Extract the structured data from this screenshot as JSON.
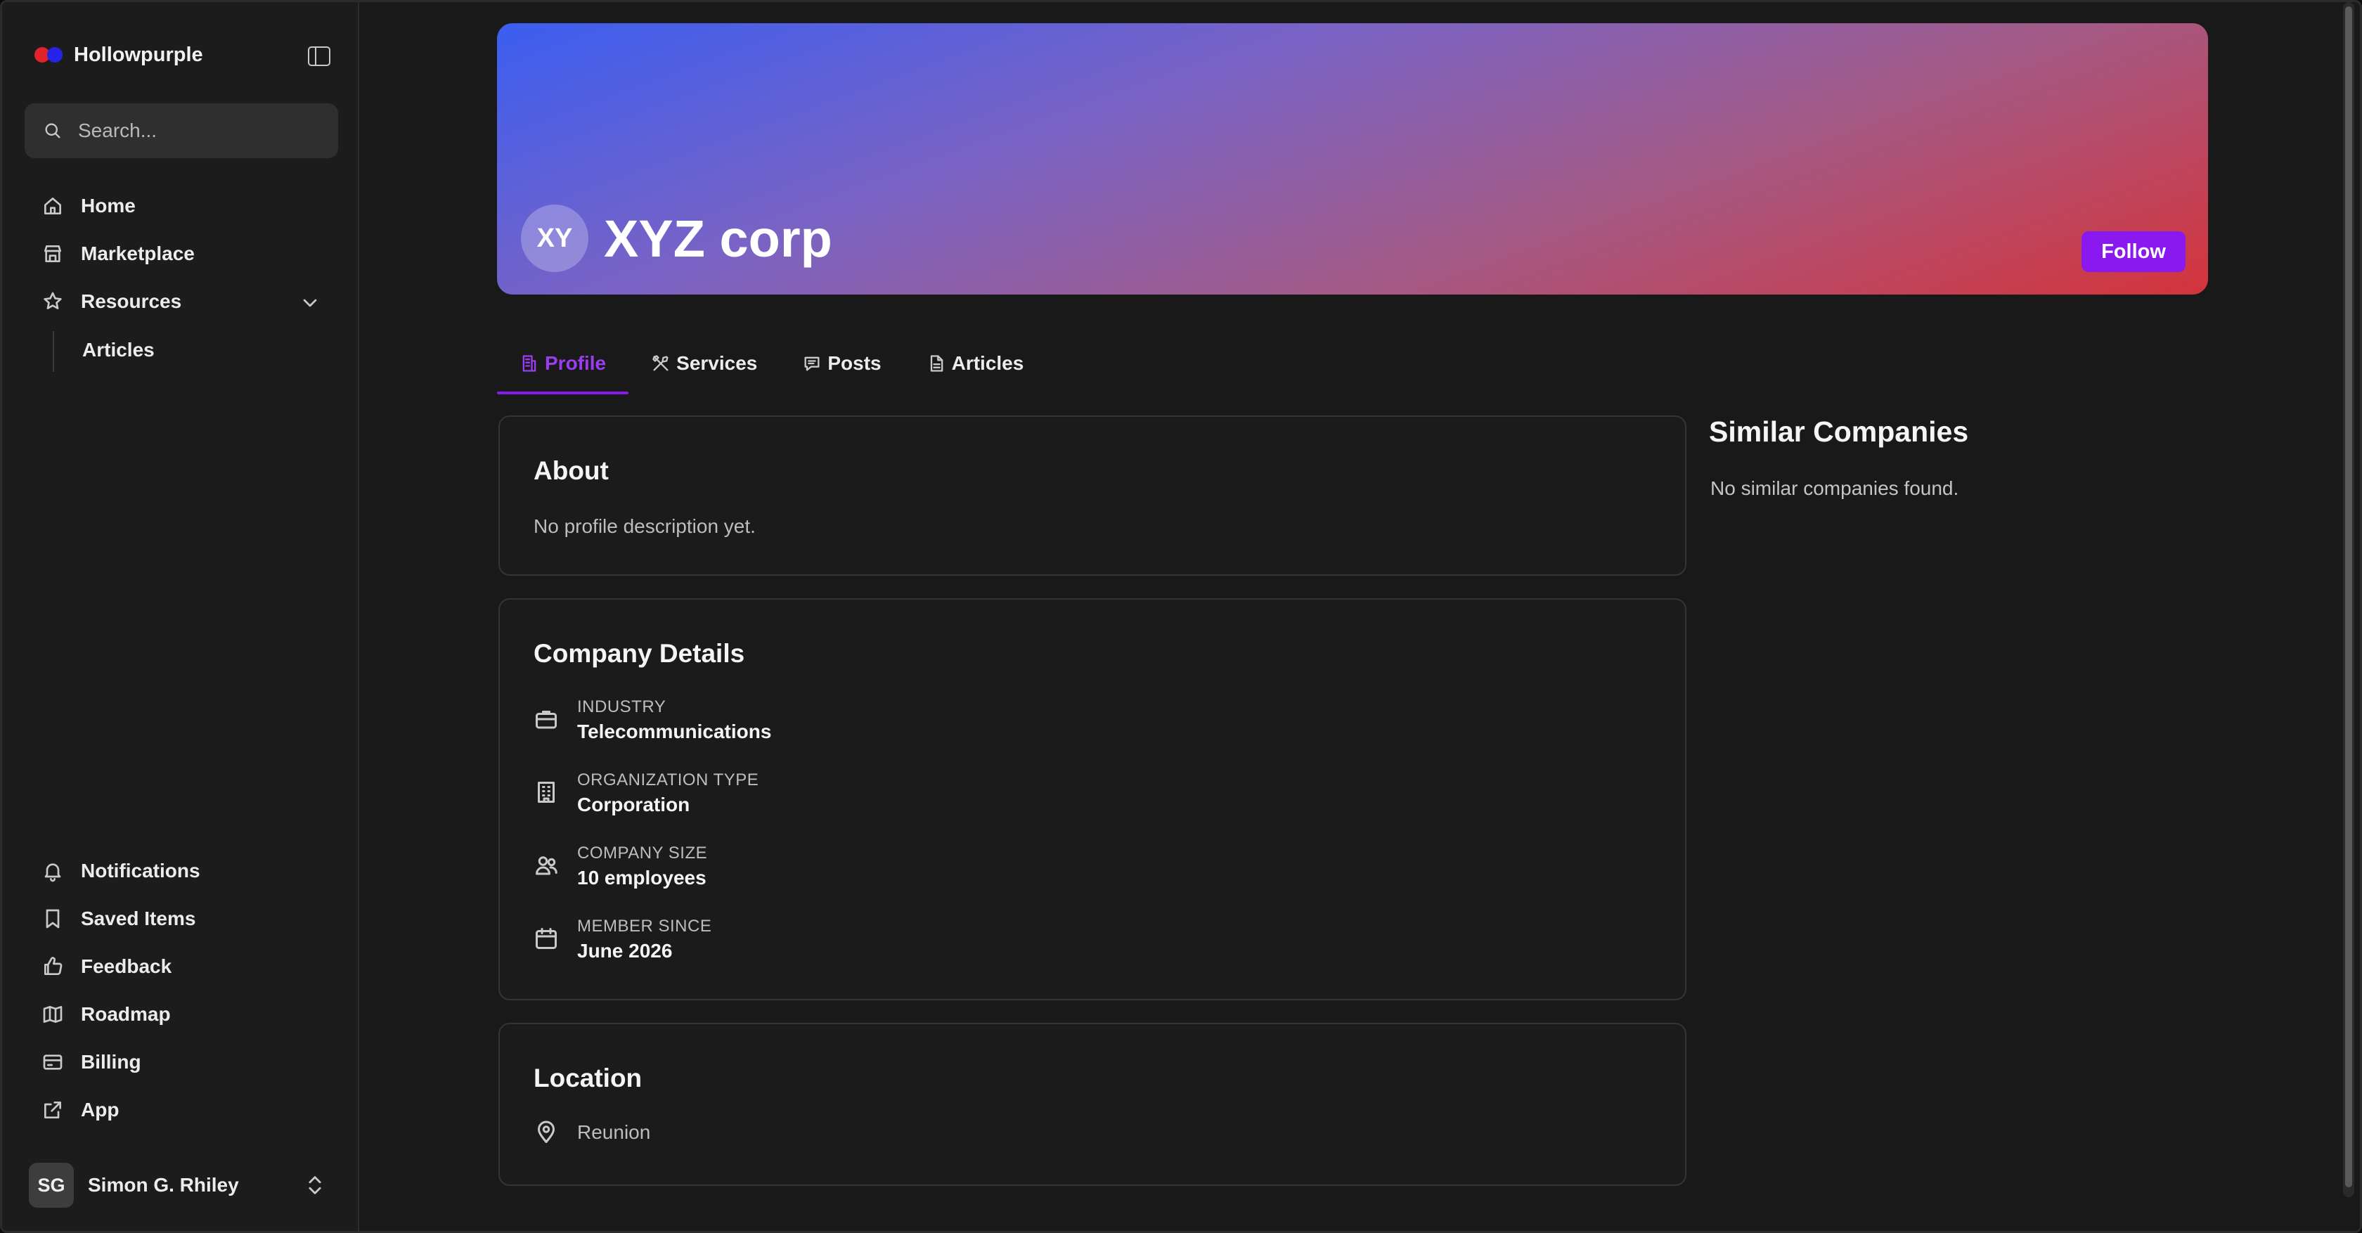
{
  "sidebar": {
    "brand": "Hollowpurple",
    "search_placeholder": "Search...",
    "nav": [
      {
        "label": "Home",
        "icon": "home-icon"
      },
      {
        "label": "Marketplace",
        "icon": "store-icon"
      },
      {
        "label": "Resources",
        "icon": "star-icon"
      }
    ],
    "subnav": [
      {
        "label": "Articles"
      }
    ],
    "bottom_nav": [
      {
        "label": "Notifications",
        "icon": "bell-icon"
      },
      {
        "label": "Saved Items",
        "icon": "bookmark-icon"
      },
      {
        "label": "Feedback",
        "icon": "thumbs-up-icon"
      },
      {
        "label": "Roadmap",
        "icon": "map-icon"
      },
      {
        "label": "Billing",
        "icon": "credit-card-icon"
      },
      {
        "label": "App",
        "icon": "external-link-icon"
      }
    ],
    "user": {
      "initials": "SG",
      "name": "Simon G. Rhiley"
    }
  },
  "company": {
    "initials": "XY",
    "name": "XYZ corp",
    "follow_label": "Follow"
  },
  "tabs": [
    {
      "label": "Profile",
      "icon": "building-icon",
      "active": true
    },
    {
      "label": "Services",
      "icon": "tools-icon"
    },
    {
      "label": "Posts",
      "icon": "chat-icon"
    },
    {
      "label": "Articles",
      "icon": "document-icon"
    }
  ],
  "about": {
    "title": "About",
    "text": "No profile description yet."
  },
  "details": {
    "title": "Company Details",
    "items": [
      {
        "label": "INDUSTRY",
        "value": "Telecommunications",
        "icon": "briefcase-icon"
      },
      {
        "label": "ORGANIZATION TYPE",
        "value": "Corporation",
        "icon": "office-building-icon"
      },
      {
        "label": "COMPANY SIZE",
        "value": "10 employees",
        "icon": "users-icon"
      },
      {
        "label": "MEMBER SINCE",
        "value": "June 2026",
        "icon": "calendar-icon"
      }
    ]
  },
  "location": {
    "title": "Location",
    "value": "Reunion",
    "icon": "map-pin-icon"
  },
  "similar": {
    "title": "Similar Companies",
    "empty": "No similar companies found."
  },
  "colors": {
    "accent": "#8a19f0",
    "background": "#191919",
    "sidebar": "#1c1c1c"
  }
}
